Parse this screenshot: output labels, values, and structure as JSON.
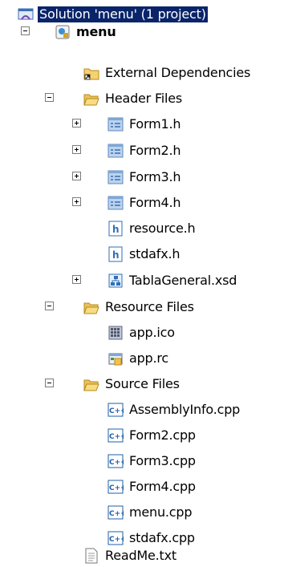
{
  "tree": {
    "solution": {
      "label": "Solution 'menu' (1 project)",
      "icon": "solution-icon"
    },
    "project": {
      "label": "menu",
      "icon": "cpp-project-icon"
    },
    "external": {
      "label": "External Dependencies",
      "icon": "folder-shortcut-icon"
    },
    "header_folder": {
      "label": "Header Files",
      "icon": "folder-open-icon"
    },
    "header_items": [
      "Form1.h",
      "Form2.h",
      "Form3.h",
      "Form4.h",
      "resource.h",
      "stdafx.h",
      "TablaGeneral.xsd"
    ],
    "resource_folder": {
      "label": "Resource Files",
      "icon": "folder-open-icon"
    },
    "resource_items": [
      "app.ico",
      "app.rc"
    ],
    "source_folder": {
      "label": "Source Files",
      "icon": "folder-open-icon"
    },
    "source_items": [
      "AssemblyInfo.cpp",
      "Form2.cpp",
      "Form3.cpp",
      "Form4.cpp",
      "menu.cpp",
      "stdafx.cpp"
    ],
    "readme": {
      "label": "ReadMe.txt",
      "icon": "text-file-icon"
    }
  },
  "colors": {
    "selection": "#0a246a",
    "folder": "#f5d270",
    "form_icon": "#7fa7d6",
    "header_icon": "#2f6fb6",
    "cpp_icon": "#1f5fa8"
  }
}
